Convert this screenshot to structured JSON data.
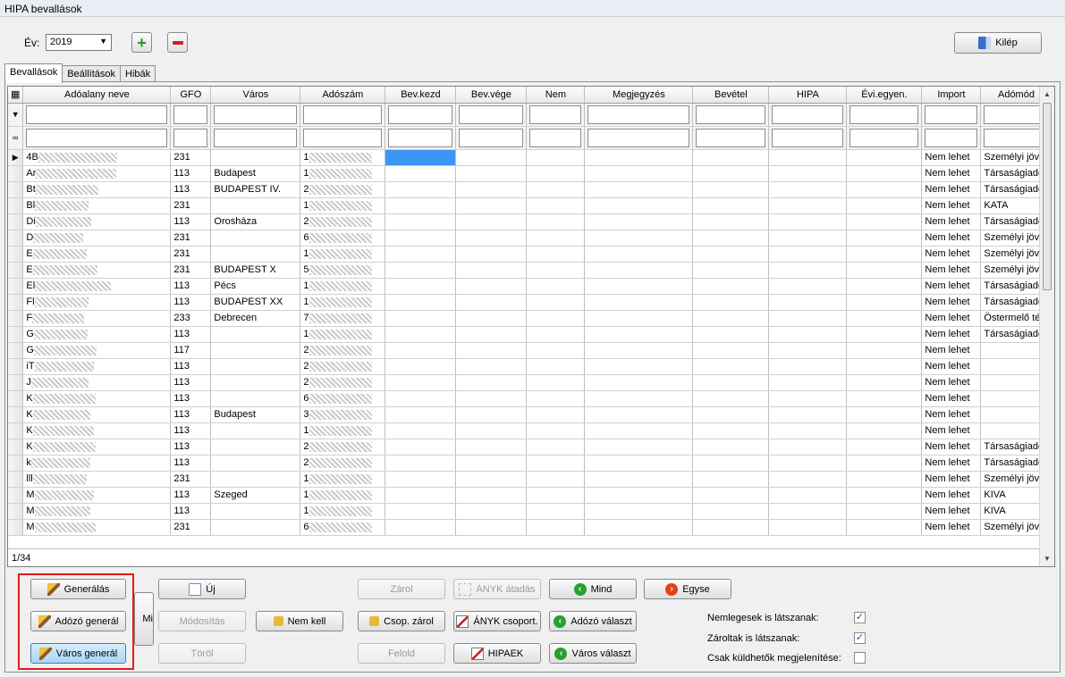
{
  "window": {
    "title": "HIPA bevallások"
  },
  "toolbar": {
    "year_label": "Év:",
    "year_value": "2019",
    "add_icon": "plus-icon",
    "remove_icon": "minus-icon",
    "exit_label": "Kilép"
  },
  "tabs": [
    "Bevallások",
    "Beállítások",
    "Hibák"
  ],
  "grid": {
    "columns": [
      "Adóalany neve",
      "GFO",
      "Város",
      "Adószám",
      "Bev.kezd",
      "Bev.vége",
      "Nem",
      "Megjegyzés",
      "Bevétel",
      "HIPA",
      "Évi.egyen.",
      "Import",
      "Adómód"
    ],
    "rows": [
      {
        "name": "4B",
        "gfo": "231",
        "varos": "",
        "adoszam": "1",
        "import": "Nem lehet",
        "adomod": "Személyi jöve"
      },
      {
        "name": "Ar",
        "gfo": "113",
        "varos": "Budapest",
        "adoszam": "1",
        "import": "Nem lehet",
        "adomod": "Társaságiadó"
      },
      {
        "name": "Bt",
        "gfo": "113",
        "varos": "BUDAPEST IV.",
        "adoszam": "2",
        "import": "Nem lehet",
        "adomod": "Társaságiadó"
      },
      {
        "name": "Bl",
        "gfo": "231",
        "varos": "",
        "adoszam": "1",
        "import": "Nem lehet",
        "adomod": "KATA"
      },
      {
        "name": "Di",
        "gfo": "113",
        "varos": "Orosháza",
        "adoszam": "2",
        "import": "Nem lehet",
        "adomod": "Társaságiadó"
      },
      {
        "name": "D",
        "gfo": "231",
        "varos": "",
        "adoszam": "6",
        "import": "Nem lehet",
        "adomod": "Személyi jöve"
      },
      {
        "name": "E",
        "gfo": "231",
        "varos": "",
        "adoszam": "1",
        "import": "Nem lehet",
        "adomod": "Személyi jöve"
      },
      {
        "name": "E",
        "gfo": "231",
        "varos": "BUDAPEST X",
        "adoszam": "5",
        "import": "Nem lehet",
        "adomod": "Személyi jöve"
      },
      {
        "name": "El",
        "gfo": "113",
        "varos": "Pécs",
        "adoszam": "1",
        "import": "Nem lehet",
        "adomod": "Társaságiadó"
      },
      {
        "name": "Fl",
        "gfo": "113",
        "varos": "BUDAPEST XX",
        "adoszam": "1",
        "import": "Nem lehet",
        "adomod": "Társaságiadó"
      },
      {
        "name": "F",
        "gfo": "233",
        "varos": "Debrecen",
        "adoszam": "7",
        "import": "Nem lehet",
        "adomod": "Östermelő téte"
      },
      {
        "name": "G",
        "gfo": "113",
        "varos": "",
        "adoszam": "1",
        "import": "Nem lehet",
        "adomod": "Társaságiadó"
      },
      {
        "name": "G",
        "gfo": "117",
        "varos": "",
        "adoszam": "2",
        "import": "Nem lehet",
        "adomod": ""
      },
      {
        "name": "iT",
        "gfo": "113",
        "varos": "",
        "adoszam": "2",
        "import": "Nem lehet",
        "adomod": ""
      },
      {
        "name": "J",
        "gfo": "113",
        "varos": "",
        "adoszam": "2",
        "import": "Nem lehet",
        "adomod": ""
      },
      {
        "name": "K",
        "gfo": "113",
        "varos": "",
        "adoszam": "6",
        "import": "Nem lehet",
        "adomod": ""
      },
      {
        "name": "K",
        "gfo": "113",
        "varos": "Budapest",
        "adoszam": "3",
        "import": "Nem lehet",
        "adomod": ""
      },
      {
        "name": "K",
        "gfo": "113",
        "varos": "",
        "adoszam": "1",
        "import": "Nem lehet",
        "adomod": ""
      },
      {
        "name": "K",
        "gfo": "113",
        "varos": "",
        "adoszam": "2",
        "import": "Nem lehet",
        "adomod": "Társaságiadó"
      },
      {
        "name": "k",
        "gfo": "113",
        "varos": "",
        "adoszam": "2",
        "import": "Nem lehet",
        "adomod": "Társaságiadó"
      },
      {
        "name": "lll",
        "gfo": "231",
        "varos": "",
        "adoszam": "1",
        "import": "Nem lehet",
        "adomod": "Személyi jöve"
      },
      {
        "name": "M",
        "gfo": "113",
        "varos": "Szeged",
        "adoszam": "1",
        "import": "Nem lehet",
        "adomod": "KIVA"
      },
      {
        "name": "M",
        "gfo": "113",
        "varos": "",
        "adoszam": "1",
        "import": "Nem lehet",
        "adomod": "KIVA"
      },
      {
        "name": "M",
        "gfo": "231",
        "varos": "",
        "adoszam": "6",
        "import": "Nem lehet",
        "adomod": "Személyi jöve"
      }
    ],
    "record_counter": "1/34"
  },
  "buttons": {
    "generalas": "Generálás",
    "adozo_general": "Adózó generál",
    "varos_general": "Város generál",
    "mi": "Mi",
    "uj": "Új",
    "modositas": "Módosítás",
    "torol": "Töröl",
    "nem_kell": "Nem kell",
    "zarol": "Zárol",
    "csop_zarol": "Csop. zárol",
    "felold": "Felold",
    "anyk_atadas": "ÁNYK átadás",
    "anyk_csoport": "ÁNYK csoport.",
    "hipaek": "HIPAEK",
    "mind": "Mind",
    "adozo_valaszt": "Adózó választ",
    "varos_valaszt": "Város választ",
    "egyse": "Egyse"
  },
  "options": [
    {
      "label": "Nemlegesek is látszanak:",
      "checked": true
    },
    {
      "label": "Zároltak is látszanak:",
      "checked": true
    },
    {
      "label": "Csak küldhetők megjelenítése:",
      "checked": false
    }
  ]
}
